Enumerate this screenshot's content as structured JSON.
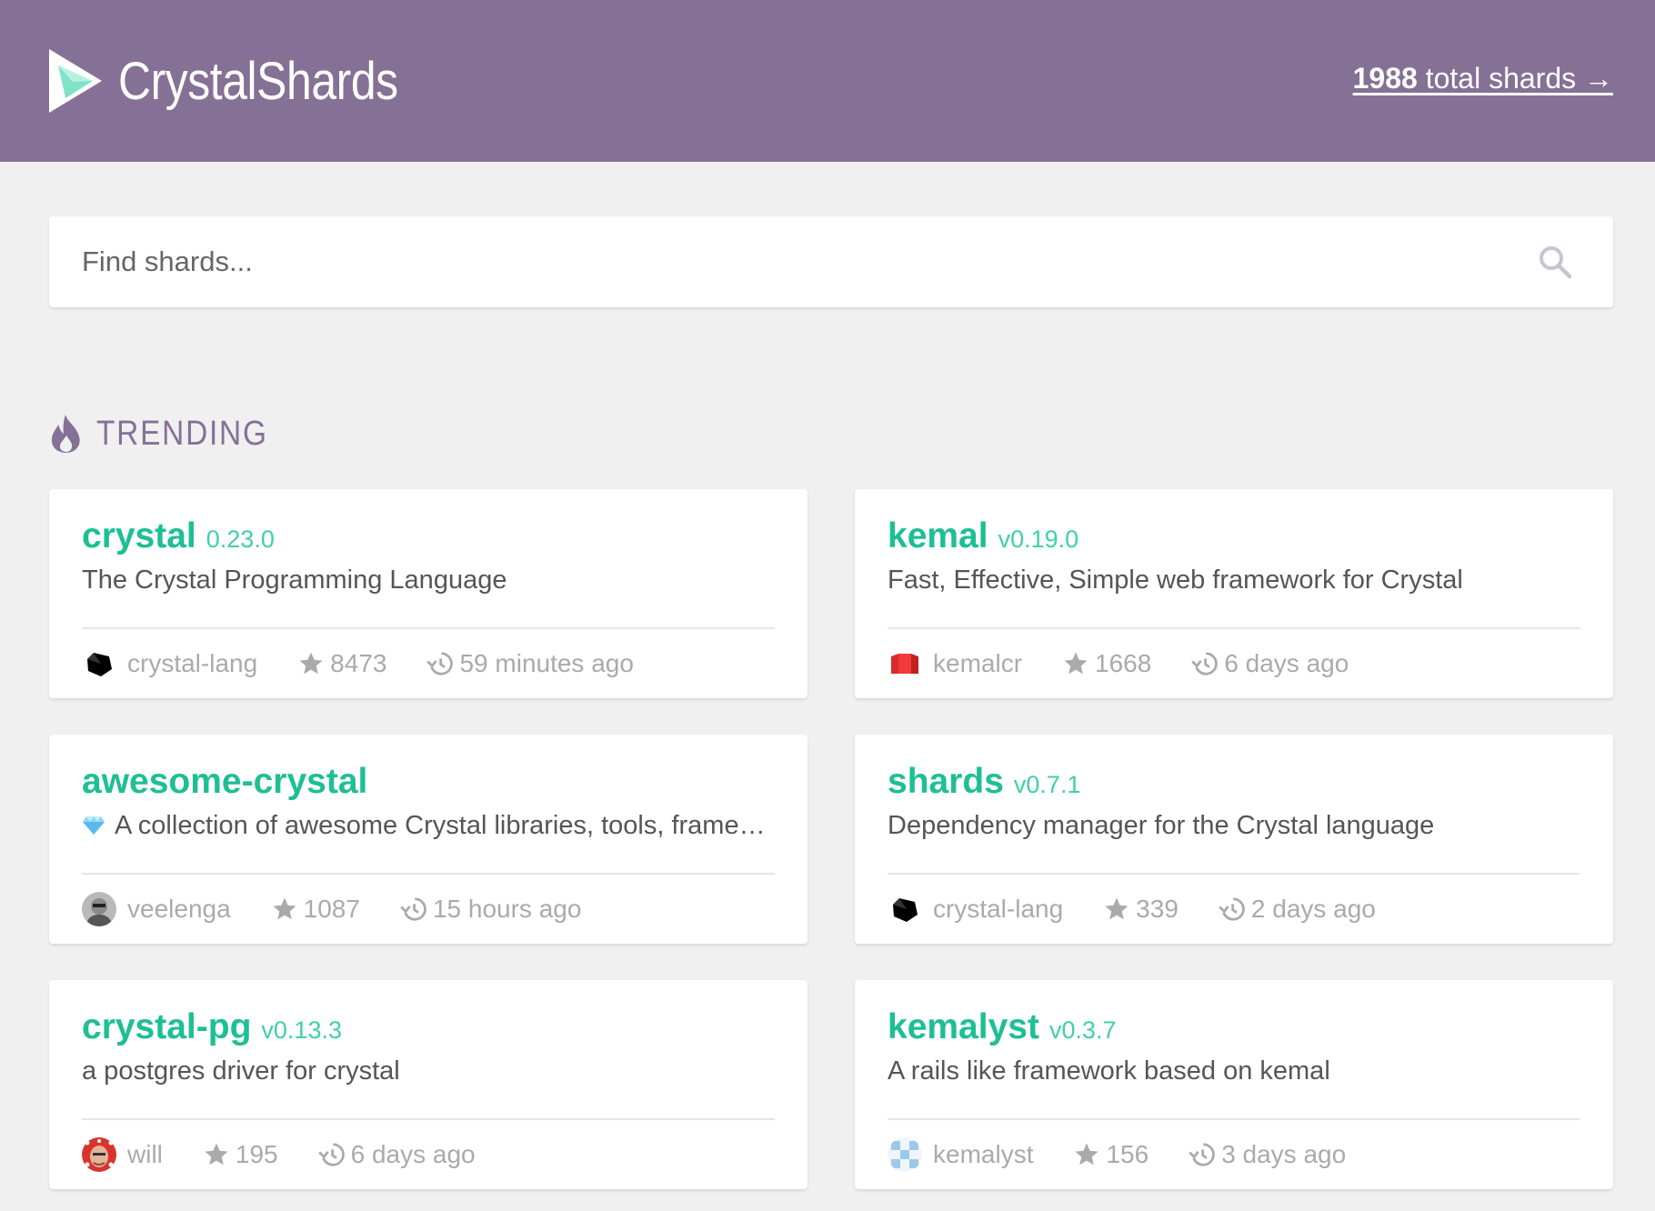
{
  "header": {
    "brand": "CrystalShards",
    "total_count": "1988",
    "total_text": " total shards →",
    "colors": {
      "header_bg": "#857195",
      "accent": "#1dbf94"
    }
  },
  "search": {
    "placeholder": "Find shards...",
    "value": ""
  },
  "trending": {
    "title": "TRENDING",
    "cards": [
      {
        "name": "crystal",
        "version": "0.23.0",
        "description": "The Crystal Programming Language",
        "owner": "crystal-lang",
        "stars": "8473",
        "updated": "59 minutes ago",
        "avatar": "crystal-lang-avatar"
      },
      {
        "name": "kemal",
        "version": "v0.19.0",
        "description": "Fast, Effective, Simple web framework for Crystal",
        "owner": "kemalcr",
        "stars": "1668",
        "updated": "6 days ago",
        "avatar": "kemalcr-avatar"
      },
      {
        "name": "awesome-crystal",
        "version": "",
        "description": "A collection of awesome Crystal libraries, tools, frameworks and software",
        "owner": "veelenga",
        "stars": "1087",
        "updated": "15 hours ago",
        "avatar": "veelenga-avatar"
      },
      {
        "name": "shards",
        "version": "v0.7.1",
        "description": "Dependency manager for the Crystal language",
        "owner": "crystal-lang",
        "stars": "339",
        "updated": "2 days ago",
        "avatar": "crystal-lang-avatar"
      },
      {
        "name": "crystal-pg",
        "version": "v0.13.3",
        "description": "a postgres driver for crystal",
        "owner": "will",
        "stars": "195",
        "updated": "6 days ago",
        "avatar": "will-avatar"
      },
      {
        "name": "kemalyst",
        "version": "v0.3.7",
        "description": "A rails like framework based on kemal",
        "owner": "kemalyst",
        "stars": "156",
        "updated": "3 days ago",
        "avatar": "kemalyst-avatar"
      }
    ]
  }
}
